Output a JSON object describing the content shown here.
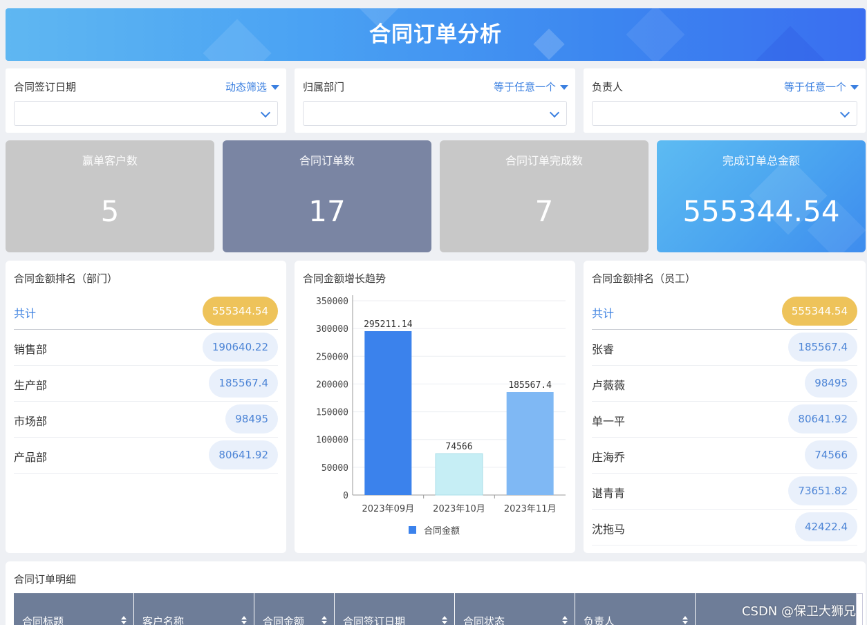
{
  "header": {
    "title": "合同订单分析"
  },
  "filters": [
    {
      "label": "合同签订日期",
      "mode": "动态筛选",
      "value": ""
    },
    {
      "label": "归属部门",
      "mode": "等于任意一个",
      "value": ""
    },
    {
      "label": "负责人",
      "mode": "等于任意一个",
      "value": ""
    }
  ],
  "kpis": [
    {
      "label": "赢单客户数",
      "value": "5",
      "color": "#c8c8c8"
    },
    {
      "label": "合同订单数",
      "value": "17",
      "color": "#7a85a3"
    },
    {
      "label": "合同订单完成数",
      "value": "7",
      "color": "#c8c8c8"
    },
    {
      "label": "完成订单总金额",
      "value": "555344.54",
      "color": "#4ca9ef"
    }
  ],
  "dept_ranking": {
    "title": "合同金额排名（部门）",
    "total": {
      "name": "共计",
      "value": "555344.54"
    },
    "rows": [
      {
        "name": "销售部",
        "value": "190640.22"
      },
      {
        "name": "生产部",
        "value": "185567.4"
      },
      {
        "name": "市场部",
        "value": "98495"
      },
      {
        "name": "产品部",
        "value": "80641.92"
      }
    ]
  },
  "growth_chart": {
    "title": "合同金额增长趋势",
    "y_ticks": [
      "0",
      "50000",
      "100000",
      "150000",
      "200000",
      "250000",
      "300000",
      "350000"
    ]
  },
  "chart_data": {
    "type": "bar",
    "categories": [
      "2023年09月",
      "2023年10月",
      "2023年11月"
    ],
    "series": [
      {
        "name": "合同金额",
        "values": [
          295211.14,
          74566,
          185567.4
        ]
      }
    ],
    "data_labels": [
      "295211.14",
      "74566",
      "185567.4"
    ],
    "ylim": [
      0,
      350000
    ],
    "grid": true,
    "legend": "bottom",
    "colors": {
      "bar1": "#3b82ec",
      "bar2": "#c6eef5",
      "bar3": "#7fb8f4"
    }
  },
  "staff_ranking": {
    "title": "合同金额排名（员工）",
    "total": {
      "name": "共计",
      "value": "555344.54"
    },
    "rows": [
      {
        "name": "张睿",
        "value": "185567.4"
      },
      {
        "name": "卢薇薇",
        "value": "98495"
      },
      {
        "name": "单一平",
        "value": "80641.92"
      },
      {
        "name": "庄海乔",
        "value": "74566"
      },
      {
        "name": "谌青青",
        "value": "73651.82"
      },
      {
        "name": "沈拖马",
        "value": "42422.4"
      }
    ]
  },
  "detail_table": {
    "title": "合同订单明细",
    "columns": [
      "合同标题",
      "客户名称",
      "合同金额",
      "合同签订日期",
      "合同状态",
      "负责人",
      ""
    ]
  },
  "watermark": "CSDN @保卫大狮兄",
  "colors": {
    "accent": "#3a7fe0",
    "gold": "#eec35a",
    "header_row": "#6e7d98"
  }
}
